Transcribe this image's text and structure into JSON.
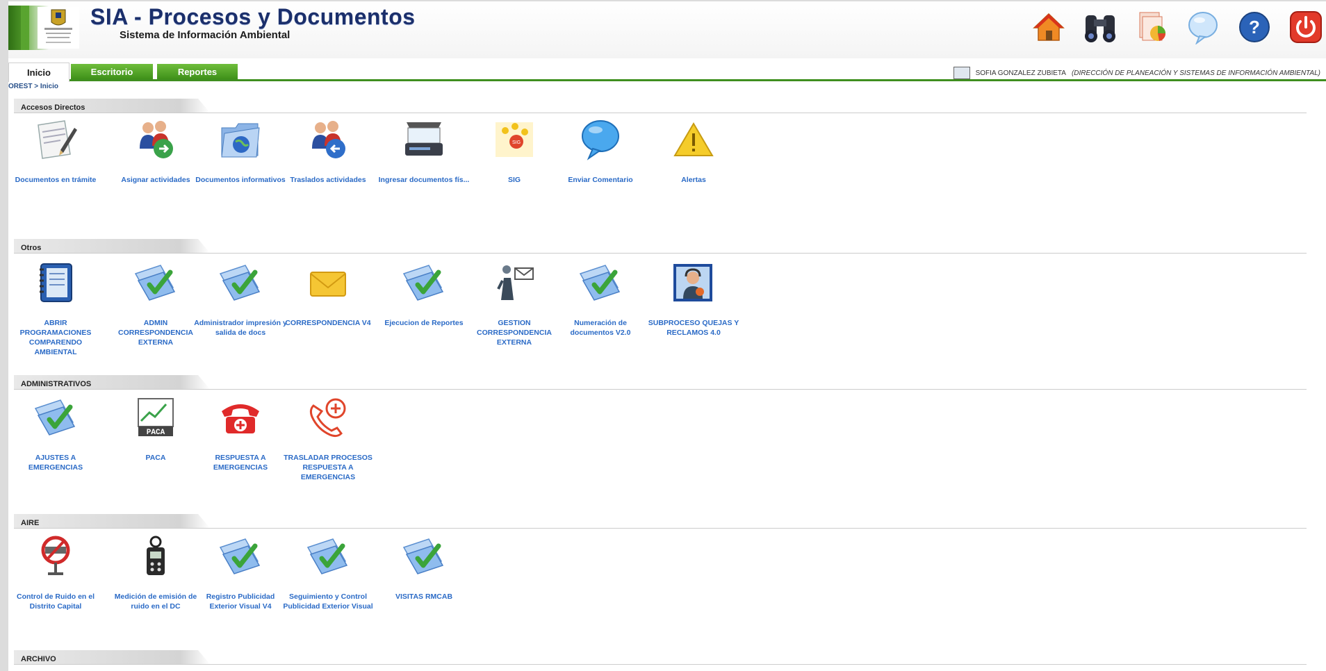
{
  "header": {
    "title": "SIA - Procesos y Documentos",
    "subtitle": "Sistema de Información Ambiental",
    "icons": [
      "home-icon",
      "binoculars-icon",
      "report-chart-icon",
      "chat-bubble-icon",
      "help-icon",
      "power-icon"
    ]
  },
  "tabs": [
    {
      "label": "Inicio"
    },
    {
      "label": "Escritorio"
    },
    {
      "label": "Reportes"
    }
  ],
  "user": {
    "name": "SOFIA GONZALEZ ZUBIETA",
    "dept": "(DIRECCIÓN DE PLANEACIÓN Y SISTEMAS DE INFORMACIÓN AMBIENTAL)"
  },
  "breadcrumb": "OREST > Inicio",
  "sections": [
    {
      "title": "Accesos Directos",
      "items": [
        {
          "label": "Documentos en trámite",
          "icon": "document-pen-icon"
        },
        {
          "label": "Asignar actividades",
          "icon": "people-assign-icon"
        },
        {
          "label": "Documentos informativos",
          "icon": "folder-globe-icon"
        },
        {
          "label": "Traslados actividades",
          "icon": "people-transfer-icon"
        },
        {
          "label": "Ingresar documentos fís...",
          "icon": "scanner-icon"
        },
        {
          "label": "SIG",
          "icon": "sig-icon"
        },
        {
          "label": "Enviar Comentario",
          "icon": "comment-bubble-icon"
        },
        {
          "label": "Alertas",
          "icon": "warning-icon"
        }
      ]
    },
    {
      "title": "Otros",
      "items": [
        {
          "label": "ABRIR PROGRAMACIONES COMPARENDO AMBIENTAL",
          "icon": "notebook-icon"
        },
        {
          "label": "ADMIN CORRESPONDENCIA EXTERNA",
          "icon": "checked-folder-icon"
        },
        {
          "label": "Administrador impresión y salida de docs",
          "icon": "checked-folder-icon"
        },
        {
          "label": "CORRESPONDENCIA V4",
          "icon": "envelope-icon"
        },
        {
          "label": "Ejecucion de Reportes",
          "icon": "checked-folder-icon"
        },
        {
          "label": "GESTION CORRESPONDENCIA EXTERNA",
          "icon": "mail-person-icon"
        },
        {
          "label": "Numeración de documentos V2.0",
          "icon": "checked-folder-icon"
        },
        {
          "label": "SUBPROCESO QUEJAS Y RECLAMOS 4.0",
          "icon": "support-agent-icon"
        }
      ]
    },
    {
      "title": "ADMINISTRATIVOS",
      "items": [
        {
          "label": "AJUSTES A EMERGENCIAS",
          "icon": "checked-folder-icon"
        },
        {
          "label": "PACA",
          "icon": "paca-icon"
        },
        {
          "label": "RESPUESTA A EMERGENCIAS",
          "icon": "emergency-phone-icon"
        },
        {
          "label": "TRASLADAR PROCESOS RESPUESTA A EMERGENCIAS",
          "icon": "phone-plus-icon"
        }
      ]
    },
    {
      "title": "AIRE",
      "items": [
        {
          "label": "Control de Ruido en el Distrito Capital",
          "icon": "noise-sign-icon"
        },
        {
          "label": "Medición de emisión de ruido en el DC",
          "icon": "sound-meter-icon"
        },
        {
          "label": "Registro Publicidad Exterior Visual V4",
          "icon": "checked-folder-icon"
        },
        {
          "label": "Seguimiento y Control Publicidad Exterior Visual",
          "icon": "checked-folder-icon"
        },
        {
          "label": "VISITAS RMCAB",
          "icon": "checked-folder-icon"
        }
      ]
    },
    {
      "title": "ARCHIVO",
      "items": []
    }
  ]
}
